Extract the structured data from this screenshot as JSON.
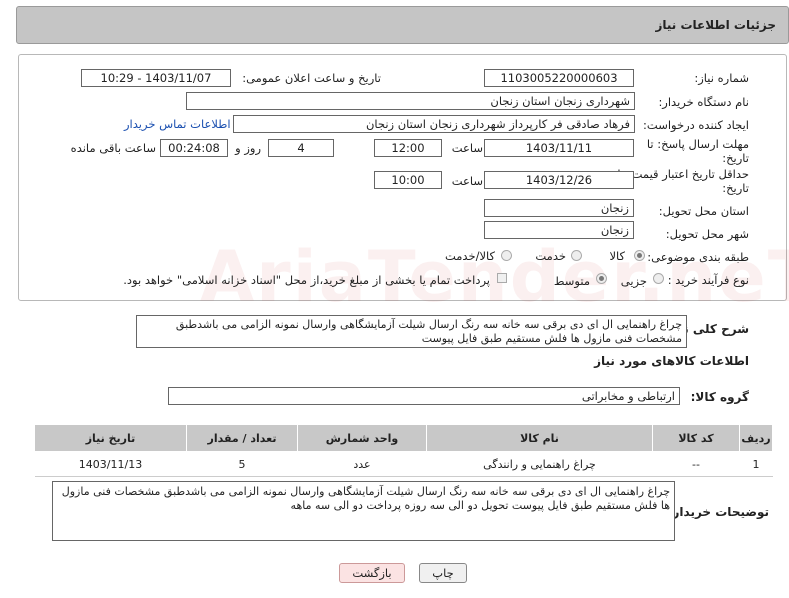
{
  "header": {
    "title": "جزئیات اطلاعات نیاز"
  },
  "fields": {
    "need_number_label": "شماره نیاز:",
    "need_number": "1103005220000603",
    "announce_label": "تاریخ و ساعت اعلان عمومی:",
    "announce_value": "1403/11/07 - 10:29",
    "buyer_org_label": "نام دستگاه خریدار:",
    "buyer_org": "شهرداری زنجان استان زنجان",
    "requester_label": "ایجاد کننده درخواست:",
    "requester": "فرهاد صادقی فر کارپرداز شهرداری زنجان استان زنجان",
    "contact_link": "اطلاعات تماس خریدار",
    "deadline_label_1": "مهلت ارسال پاسخ: تا",
    "deadline_label_2": "تاریخ:",
    "deadline_date": "1403/11/11",
    "time_label": "ساعت",
    "deadline_time": "12:00",
    "days_value": "4",
    "days_label": "روز و",
    "remaining_time": "00:24:08",
    "remaining_label": "ساعت باقی مانده",
    "validity_label_1": "حداقل تاریخ اعتبار قیمت: تا",
    "validity_label_2": "تاریخ:",
    "validity_date": "1403/12/26",
    "validity_time_label": "ساعت",
    "validity_time": "10:00",
    "province_label": "استان محل تحویل:",
    "province": "زنجان",
    "city_label": "شهر محل تحویل:",
    "city": "زنجان",
    "category_label": "طبقه بندی موضوعی:",
    "category_options": [
      "کالا",
      "خدمت",
      "کالا/خدمت"
    ],
    "process_label": "نوع فرآیند خرید :",
    "process_options": [
      "جزیی",
      "متوسط"
    ],
    "payment_note": "پرداخت تمام یا بخشی از مبلغ خرید،از محل \"اسناد خزانه اسلامی\" خواهد بود."
  },
  "description": {
    "label": "شرح کلی نیاز:",
    "text": "چراغ راهنمایی  ال ای دی برقی سه خانه سه رنگ ارسال شیلت آزمایشگاهی وارسال نمونه الزامی می باشدطبق مشخصات فنی مازول ها فلش مستقیم طبق فایل پیوست"
  },
  "goods": {
    "section_title": "اطلاعات کالاهای مورد نیاز",
    "group_label": "گروه کالا:",
    "group_value": "ارتباطی و مخابراتی",
    "columns": [
      "ردیف",
      "کد کالا",
      "نام کالا",
      "واحد شمارش",
      "تعداد / مقدار",
      "تاریخ نیاز"
    ],
    "rows": [
      [
        "1",
        "--",
        "چراغ راهنمایی و رانندگی",
        "عدد",
        "5",
        "1403/11/13"
      ]
    ]
  },
  "buyer_notes": {
    "label": "توضیحات خریدار:",
    "text": "چراغ راهنمایی  ال ای دی برقی سه خانه سه رنگ ارسال شیلت آزمایشگاهی وارسال نمونه الزامی می باشدطبق مشخصات فنی مازول ها فلش مستقیم طبق فایل پیوست تحویل دو الی سه روزه پرداخت دو الی سه ماهه"
  },
  "buttons": {
    "print": "چاپ",
    "back": "بازگشت"
  },
  "watermark": "AriaTender.neT"
}
